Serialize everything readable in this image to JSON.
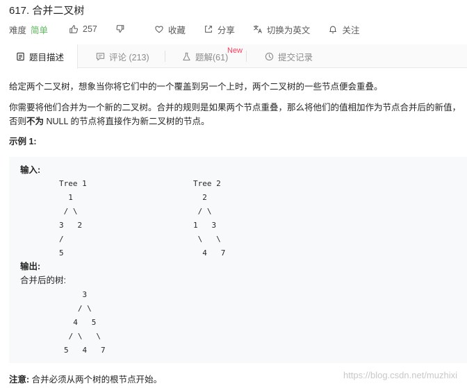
{
  "problem": {
    "title": "617. 合并二叉树",
    "difficulty_label": "难度",
    "difficulty_value": "简单",
    "likes": "257",
    "favorite_label": "收藏",
    "share_label": "分享",
    "translate_label": "切换为英文",
    "follow_label": "关注"
  },
  "tabs": [
    {
      "label": "题目描述"
    },
    {
      "label": "评论 (213)"
    },
    {
      "label": "题解(61)",
      "badge": "New"
    },
    {
      "label": "提交记录"
    }
  ],
  "description": {
    "p1": "给定两个二叉树，想象当你将它们中的一个覆盖到另一个上时，两个二叉树的一些节点便会重叠。",
    "p2_a": "你需要将他们合并为一个新的二叉树。合并的规则是如果两个节点重叠，那么将他们的值相加作为节点合并后的新值，否则",
    "p2_bold": "不为",
    "p2_b": " NULL 的节点将直接作为新二叉树的节点。",
    "example_heading": "示例 1:"
  },
  "example": {
    "input_label": "输入:",
    "tree1": "Tree 1\n  1\n / \\\n3   2\n/\n5",
    "tree2": "Tree 2\n  2\n / \\\n1   3\n \\   \\\n  4   7",
    "output_label": "输出:",
    "merged_label": "合并后的树:",
    "merged": "    3\n   / \\\n  4   5\n / \\   \\\n5   4   7"
  },
  "note": {
    "bold": "注意:",
    "text": " 合并必须从两个树的根节点开始。"
  },
  "watermark": "https://blog.csdn.net/muzhixi",
  "colors": {
    "easy": "#5cb85c",
    "new_badge": "#ff3b5c",
    "tab_bg": "#fafafa",
    "code_bg": "#f7f9fa"
  },
  "icons": [
    "thumbs-up-icon",
    "thumbs-down-icon",
    "heart-icon",
    "share-icon",
    "translate-icon",
    "bell-icon",
    "document-icon",
    "comment-icon",
    "flask-icon",
    "clock-icon"
  ]
}
